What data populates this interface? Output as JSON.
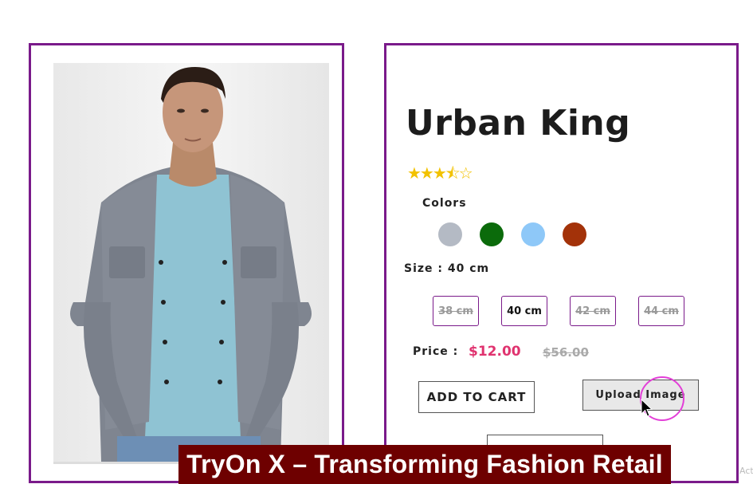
{
  "product": {
    "title": "Urban King",
    "rating_stars": "★★★⯪☆",
    "colors_label": "Colors",
    "colors": [
      "#b4bac4",
      "#0b6b0b",
      "#8ec8f8",
      "#a33209"
    ],
    "size_label": "Size : 40 cm",
    "sizes": [
      {
        "label": "38 cm",
        "available": false
      },
      {
        "label": "40 cm",
        "available": true
      },
      {
        "label": "42 cm",
        "available": false
      },
      {
        "label": "44 cm",
        "available": false
      }
    ],
    "price_label": "Price :",
    "price_current": "$12.00",
    "price_original": "$56.00",
    "add_to_cart": "ADD TO CART",
    "upload_image": "Upload Image"
  },
  "caption": "TryOn X – Transforming Fashion Retail",
  "watermark": "Act",
  "icons": [
    "cursor-icon",
    "star-icon"
  ],
  "accent_color": "#7a1a8a"
}
